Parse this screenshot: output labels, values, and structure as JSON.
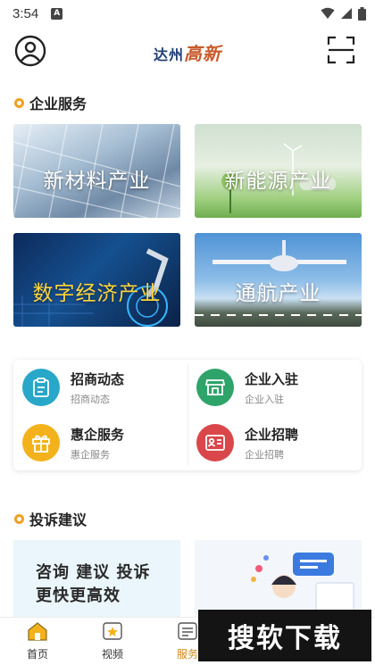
{
  "status_bar": {
    "time": "3:54",
    "notification_glyph": "A"
  },
  "header": {
    "brand_part1": "达州",
    "brand_part2": "高新",
    "avatar_icon": "user-circle-icon",
    "scan_icon": "scan-icon"
  },
  "enterprise_services": {
    "title": "企业服务",
    "industries": [
      {
        "label": "新材料产业"
      },
      {
        "label": "新能源产业"
      },
      {
        "label": "数字经济产业"
      },
      {
        "label": "通航产业"
      }
    ],
    "services": [
      {
        "title": "招商动态",
        "subtitle": "招商动态",
        "color": "#28a7c9",
        "icon": "clipboard-icon"
      },
      {
        "title": "企业入驻",
        "subtitle": "企业入驻",
        "color": "#2ea46a",
        "icon": "storefront-icon"
      },
      {
        "title": "惠企服务",
        "subtitle": "惠企服务",
        "color": "#f3b21c",
        "icon": "gift-icon"
      },
      {
        "title": "企业招聘",
        "subtitle": "企业招聘",
        "color": "#d9474b",
        "icon": "id-card-icon"
      }
    ]
  },
  "complaints": {
    "title": "投诉建议",
    "banner_line1": "咨询 建议 投诉",
    "banner_line2": "更快更高效"
  },
  "tab_bar": {
    "tabs": [
      {
        "label": "首页",
        "icon": "home-icon"
      },
      {
        "label": "视频",
        "icon": "star-video-icon"
      },
      {
        "label": "服务",
        "icon": "service-icon"
      }
    ],
    "active_index": 2
  },
  "watermark": {
    "text": "搜软下载"
  },
  "colors": {
    "accent": "#f0a020",
    "brand_blue": "#1f3e74",
    "brand_orange": "#c85a2a"
  }
}
